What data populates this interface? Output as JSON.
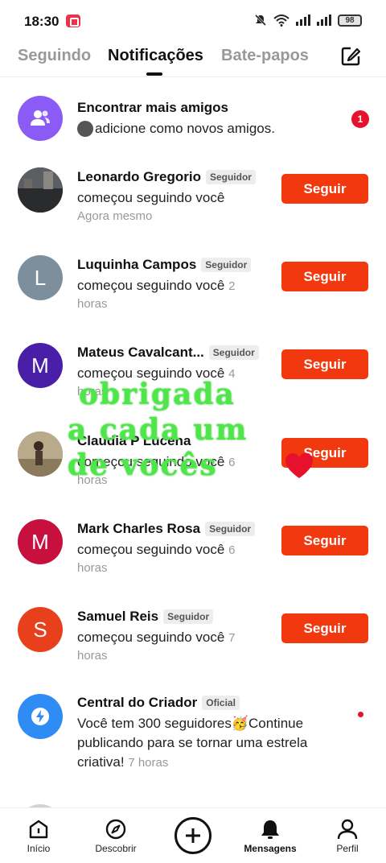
{
  "status": {
    "time": "18:30",
    "battery": "98"
  },
  "tabs": [
    {
      "label": "Seguindo"
    },
    {
      "label": "Notificações"
    },
    {
      "label": "Bate-papos"
    }
  ],
  "find_friends": {
    "title": "Encontrar mais amigos",
    "desc": "adicione como novos amigos.",
    "count": "1"
  },
  "notifications": [
    {
      "name": "Leonardo Gregorio",
      "badge": "Seguidor",
      "desc": "começou seguindo você",
      "time": "Agora mesmo",
      "button": "Seguir",
      "initial": ""
    },
    {
      "name": "Luquinha Campos",
      "badge": "Seguidor",
      "desc": "começou seguindo você",
      "time_inline": "2",
      "time": "horas",
      "button": "Seguir",
      "initial": "L"
    },
    {
      "name": "Mateus Cavalcant...",
      "badge": "Seguidor",
      "desc": "começou seguindo você",
      "time_inline": "4",
      "time": "horas",
      "button": "Seguir",
      "initial": "M"
    },
    {
      "name": "Claudia P Lucena",
      "badge": "",
      "desc": "começou seguindo você",
      "time_inline": "6",
      "time": "horas",
      "button": "Seguir",
      "initial": ""
    },
    {
      "name": "Mark Charles Rosa",
      "badge": "Seguidor",
      "desc": "começou seguindo você",
      "time_inline": "6",
      "time": "horas",
      "button": "Seguir",
      "initial": "M"
    },
    {
      "name": "Samuel Reis",
      "badge": "Seguidor",
      "desc": "começou seguindo você",
      "time_inline": "7",
      "time": "horas",
      "button": "Seguir",
      "initial": "S"
    }
  ],
  "creator": {
    "name": "Central do Criador",
    "badge": "Oficial",
    "line1": "Você tem 300 seguidores🥳Continue",
    "line2": "publicando para se tornar uma estrela",
    "line3": "criativa!",
    "time": "7 horas"
  },
  "overlay": {
    "line1": "obrigada",
    "line2": "a cada um",
    "line3": "de vocês"
  },
  "nav": {
    "home": "Início",
    "discover": "Descobrir",
    "messages": "Mensagens",
    "profile": "Perfil"
  },
  "colors": {
    "accent": "#f2380e",
    "avatar_friends": "#8a5cf5",
    "avatar_L": "#7d8e9c",
    "avatar_M1": "#4a1fa8",
    "avatar_M2": "#c8103e",
    "avatar_S": "#e8401c",
    "avatar_creator": "#2f8cf5",
    "overlay_text": "#4fe64a"
  },
  "icons": [
    "recording-icon",
    "mute-icon",
    "wifi-icon",
    "signal-icon",
    "battery-icon",
    "compose-icon",
    "friends-icon",
    "lightning-icon",
    "home-icon",
    "compass-icon",
    "plus-icon",
    "bell-icon",
    "person-icon",
    "heart-icon"
  ]
}
